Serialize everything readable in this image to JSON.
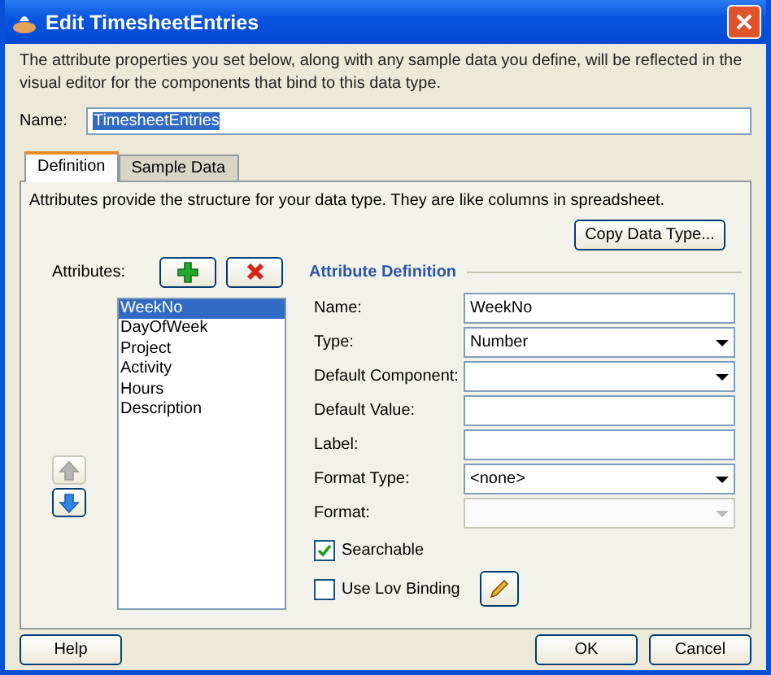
{
  "window": {
    "title": "Edit TimesheetEntries"
  },
  "intro": "The attribute properties you set below, along with any sample data you define, will be reflected in the visual editor for the components that bind to this data type.",
  "name_field": {
    "label": "Name:",
    "value": "TimesheetEntries",
    "text_selected": true
  },
  "tabs": [
    {
      "label": "Definition",
      "selected": true
    },
    {
      "label": "Sample Data",
      "selected": false
    }
  ],
  "panel_intro": "Attributes provide the structure for your data type. They are like columns in spreadsheet.",
  "copy_button": {
    "label": "Copy Data Type..."
  },
  "attributes": {
    "label": "Attributes:",
    "items": [
      {
        "label": "WeekNo",
        "selected": true
      },
      {
        "label": "DayOfWeek",
        "selected": false
      },
      {
        "label": "Project",
        "selected": false
      },
      {
        "label": "Activity",
        "selected": false
      },
      {
        "label": "Hours",
        "selected": false
      },
      {
        "label": "Description",
        "selected": false
      }
    ],
    "move_up": {
      "disabled": true
    },
    "move_down": {
      "disabled": false
    }
  },
  "definition": {
    "title": "Attribute Definition",
    "fields": [
      {
        "kind": "text",
        "label": "Name:",
        "value": "WeekNo",
        "disabled": false
      },
      {
        "kind": "select",
        "label": "Type:",
        "value": "Number",
        "disabled": false
      },
      {
        "kind": "select",
        "label": "Default Component:",
        "disabled": false
      },
      {
        "kind": "text",
        "label": "Default Value:",
        "disabled": false
      },
      {
        "kind": "text",
        "label": "Label:",
        "disabled": false
      },
      {
        "kind": "select",
        "label": "Format Type:",
        "value": "<none>",
        "disabled": false
      },
      {
        "kind": "select",
        "label": "Format:",
        "disabled": true
      }
    ],
    "checks": [
      {
        "label": "Searchable",
        "checked": true,
        "edit_button": false
      },
      {
        "label": "Use Lov Binding",
        "checked": false,
        "edit_button": true
      }
    ]
  },
  "help_button": {
    "label": "Help"
  },
  "buttons": [
    {
      "label": "OK"
    },
    {
      "label": "Cancel"
    }
  ]
}
